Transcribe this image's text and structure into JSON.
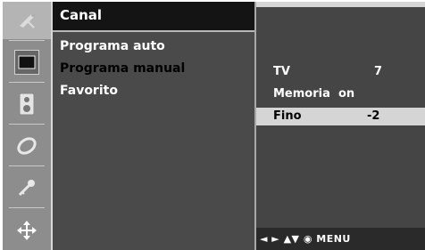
{
  "sidebar": {
    "icons": [
      {
        "name": "satellite-dish-icon"
      },
      {
        "name": "picture-icon"
      },
      {
        "name": "speaker-icon"
      },
      {
        "name": "clock-icon"
      },
      {
        "name": "key-icon"
      },
      {
        "name": "input-arrows-icon"
      }
    ]
  },
  "menu": {
    "title": "Canal",
    "items": [
      {
        "label": "Programa auto"
      },
      {
        "label": "Programa manual"
      },
      {
        "label": "Favorito"
      }
    ]
  },
  "panel": {
    "rows": [
      {
        "label": "TV",
        "value": "7"
      },
      {
        "label": "Memoria",
        "value": "on"
      },
      {
        "label": "Fino",
        "value": "-2"
      }
    ],
    "footer": "◄ ► ▲▼ ◉ MENU"
  }
}
